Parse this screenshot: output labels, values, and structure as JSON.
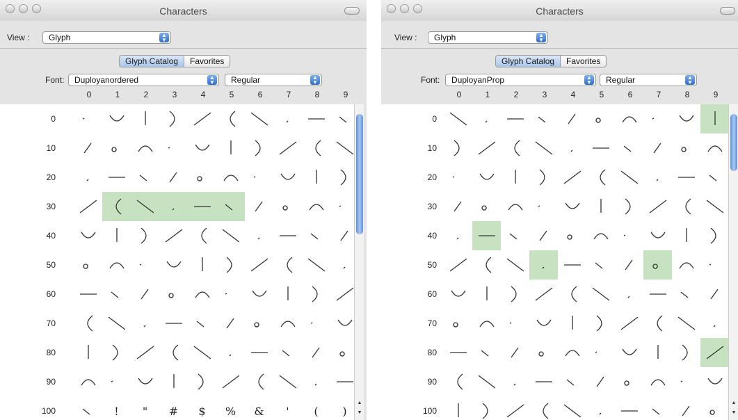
{
  "windows": [
    {
      "title": "Characters",
      "view_label": "View :",
      "view_value": "Glyph",
      "tabs": [
        "Glyph Catalog",
        "Favorites"
      ],
      "selected_tab": 0,
      "font_label": "Font:",
      "font_value": "Duployanordered",
      "style_value": "Regular",
      "columns": [
        "0",
        "1",
        "2",
        "3",
        "4",
        "5",
        "6",
        "7",
        "8",
        "9"
      ],
      "rows": [
        "0",
        "10",
        "20",
        "30",
        "40",
        "50",
        "60",
        "70",
        "80",
        "90",
        "100"
      ],
      "highlighted": [
        31,
        32,
        33,
        34,
        35
      ],
      "text_glyphs": [
        {
          "i": 101,
          "ch": "!"
        },
        {
          "i": 102,
          "ch": "\""
        },
        {
          "i": 103,
          "ch": "#"
        },
        {
          "i": 104,
          "ch": "$"
        },
        {
          "i": 105,
          "ch": "%"
        },
        {
          "i": 106,
          "ch": "&"
        },
        {
          "i": 107,
          "ch": "'"
        },
        {
          "i": 108,
          "ch": "("
        },
        {
          "i": 109,
          "ch": ")"
        },
        {
          "i": 110,
          "ch": "*"
        }
      ],
      "scrollbar": {
        "thumb_start_fraction": 0.03,
        "thumb_size_fraction": 0.38
      }
    },
    {
      "title": "Characters",
      "view_label": "View :",
      "view_value": "Glyph",
      "tabs": [
        "Glyph Catalog",
        "Favorites"
      ],
      "selected_tab": 0,
      "font_label": "Font:",
      "font_value": "DuployanProp",
      "style_value": "Regular",
      "columns": [
        "0",
        "1",
        "2",
        "3",
        "4",
        "5",
        "6",
        "7",
        "8",
        "9"
      ],
      "rows": [
        "0",
        "10",
        "20",
        "30",
        "40",
        "50",
        "60",
        "70",
        "80",
        "90",
        "100"
      ],
      "highlighted": [
        9,
        41,
        53,
        57,
        89
      ],
      "text_glyphs": [],
      "scrollbar": {
        "thumb_start_fraction": 0.03,
        "thumb_size_fraction": 0.18
      }
    }
  ]
}
